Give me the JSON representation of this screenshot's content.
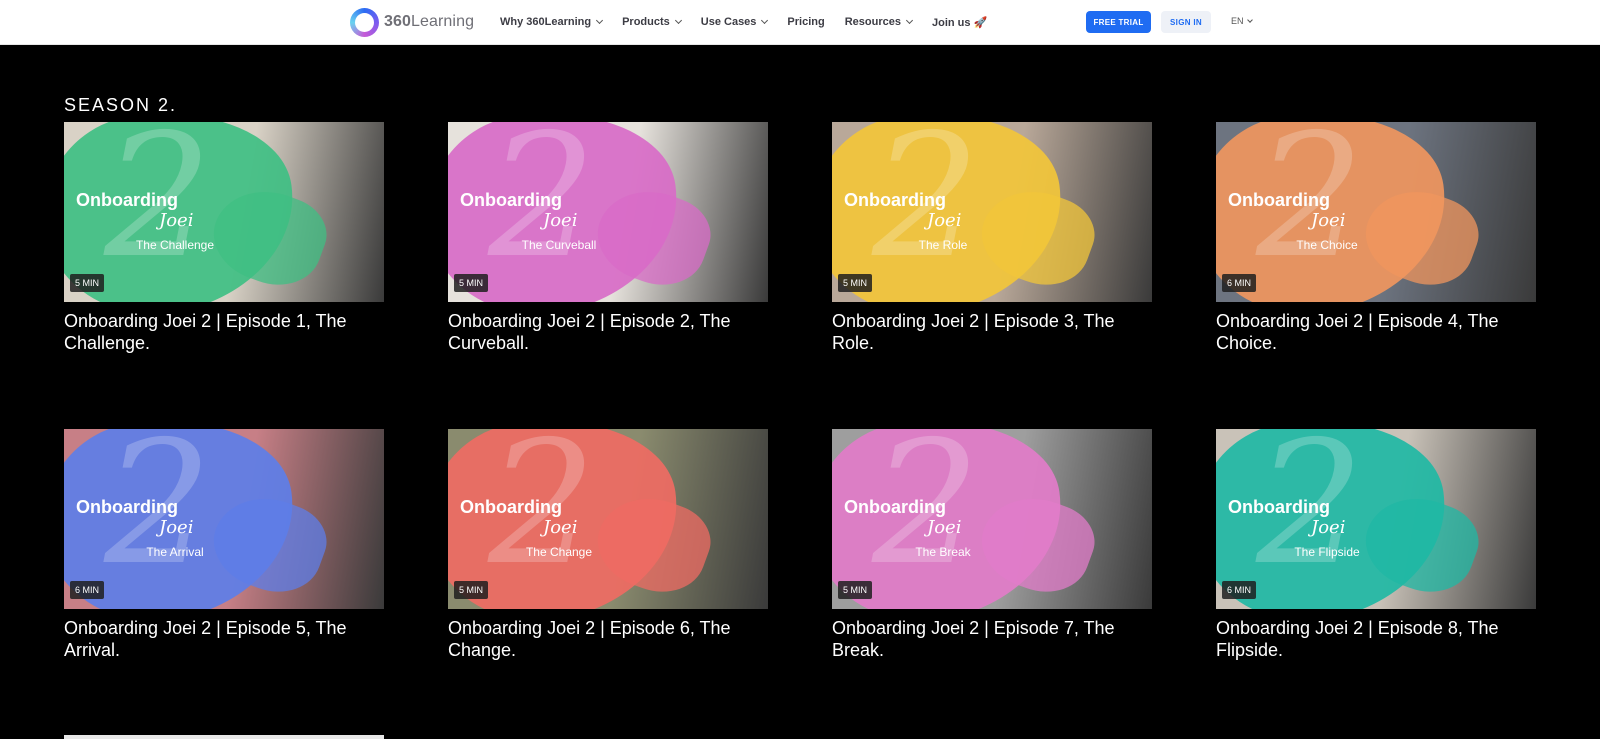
{
  "nav": {
    "logo_bold": "360",
    "logo_rest": "Learning",
    "menu": [
      {
        "label": "Why 360Learning",
        "dropdown": true
      },
      {
        "label": "Products",
        "dropdown": true
      },
      {
        "label": "Use Cases",
        "dropdown": true
      },
      {
        "label": "Pricing",
        "dropdown": false
      },
      {
        "label": "Resources",
        "dropdown": true
      },
      {
        "label": "Join us 🚀",
        "dropdown": false
      }
    ],
    "free_trial": "FREE TRIAL",
    "sign_in": "SIGN IN",
    "lang": "EN"
  },
  "section_title": "SEASON 2.",
  "thumb_common": {
    "line1": "Onboarding",
    "line2": "Joei"
  },
  "episodes": [
    {
      "subtitle": "The Challenge",
      "duration": "5 MIN",
      "title": "Onboarding Joei 2 | Episode 1, The Challenge.",
      "splash": "#3fbf83",
      "photo": "#d9d2c6"
    },
    {
      "subtitle": "The Curveball",
      "duration": "5 MIN",
      "title": "Onboarding Joei 2 | Episode 2, The Curveball.",
      "splash": "#d86bc7",
      "photo": "#e6e2dc"
    },
    {
      "subtitle": "The Role",
      "duration": "5 MIN",
      "title": "Onboarding Joei 2 | Episode 3, The Role.",
      "splash": "#f2c53a",
      "photo": "#b9a899"
    },
    {
      "subtitle": "The Choice",
      "duration": "6 MIN",
      "title": "Onboarding Joei 2 | Episode 4, The Choice.",
      "splash": "#f0965e",
      "photo": "#6d7480"
    },
    {
      "subtitle": "The Arrival",
      "duration": "6 MIN",
      "title": "Onboarding Joei 2 | Episode 5, The Arrival.",
      "splash": "#5d7ee8",
      "photo": "#c77f86"
    },
    {
      "subtitle": "The Change",
      "duration": "5 MIN",
      "title": "Onboarding Joei 2 | Episode 6, The Change.",
      "splash": "#ef6b63",
      "photo": "#8a8b6e"
    },
    {
      "subtitle": "The Break",
      "duration": "5 MIN",
      "title": "Onboarding Joei 2 | Episode 7, The Break.",
      "splash": "#e27cc9",
      "photo": "#9e9e9e"
    },
    {
      "subtitle": "The Flipside",
      "duration": "6 MIN",
      "title": "Onboarding Joei 2 | Episode 8, The Flipside.",
      "splash": "#1fb8a4",
      "photo": "#c9c2b8"
    }
  ]
}
